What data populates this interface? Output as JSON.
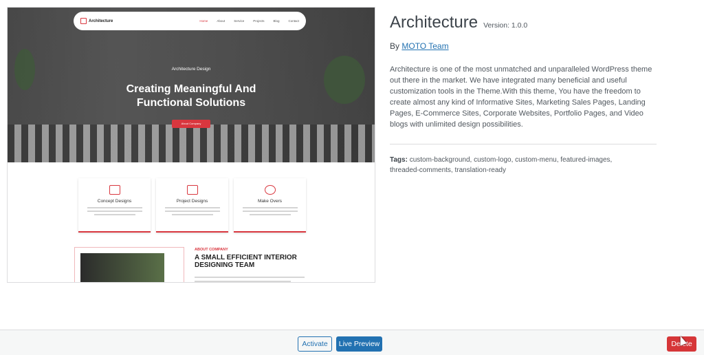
{
  "preview": {
    "logo_text": "Architecture",
    "menu": [
      "Home",
      "About",
      "Service",
      "Projects",
      "Blog",
      "Contact"
    ],
    "kicker": "Architecture Design",
    "headline_line1": "Creating Meaningful And",
    "headline_line2": "Functional Solutions",
    "cta": "About Company",
    "cards": [
      {
        "title": "Concept Designs"
      },
      {
        "title": "Project Designs"
      },
      {
        "title": "Make Overs"
      }
    ],
    "about_label": "ABOUT COMPANY",
    "about_title": "A SMALL EFFICIENT INTERIOR DESIGNING TEAM"
  },
  "theme": {
    "name": "Architecture",
    "version": "Version: 1.0.0",
    "by": "By",
    "author": "MOTO Team",
    "description": "Architecture is one of the most unmatched and unparalleled WordPress theme out there in the market. We have integrated many beneficial and useful customization tools in the Theme.With this theme, You have the freedom to create almost any kind of Informative Sites, Marketing Sales Pages, Landing Pages, E-Commerce Sites, Corporate Websites, Portfolio Pages, and Video blogs with unlimited design possibilities.",
    "tags_label": "Tags:",
    "tags": "custom-background, custom-logo, custom-menu, featured-images, threaded-comments, translation-ready"
  },
  "actions": {
    "activate": "Activate",
    "live_preview": "Live Preview",
    "delete": "Delete"
  },
  "colors": {
    "primary": "#2271b1",
    "danger": "#d63638",
    "theme_accent": "#d9363e"
  }
}
